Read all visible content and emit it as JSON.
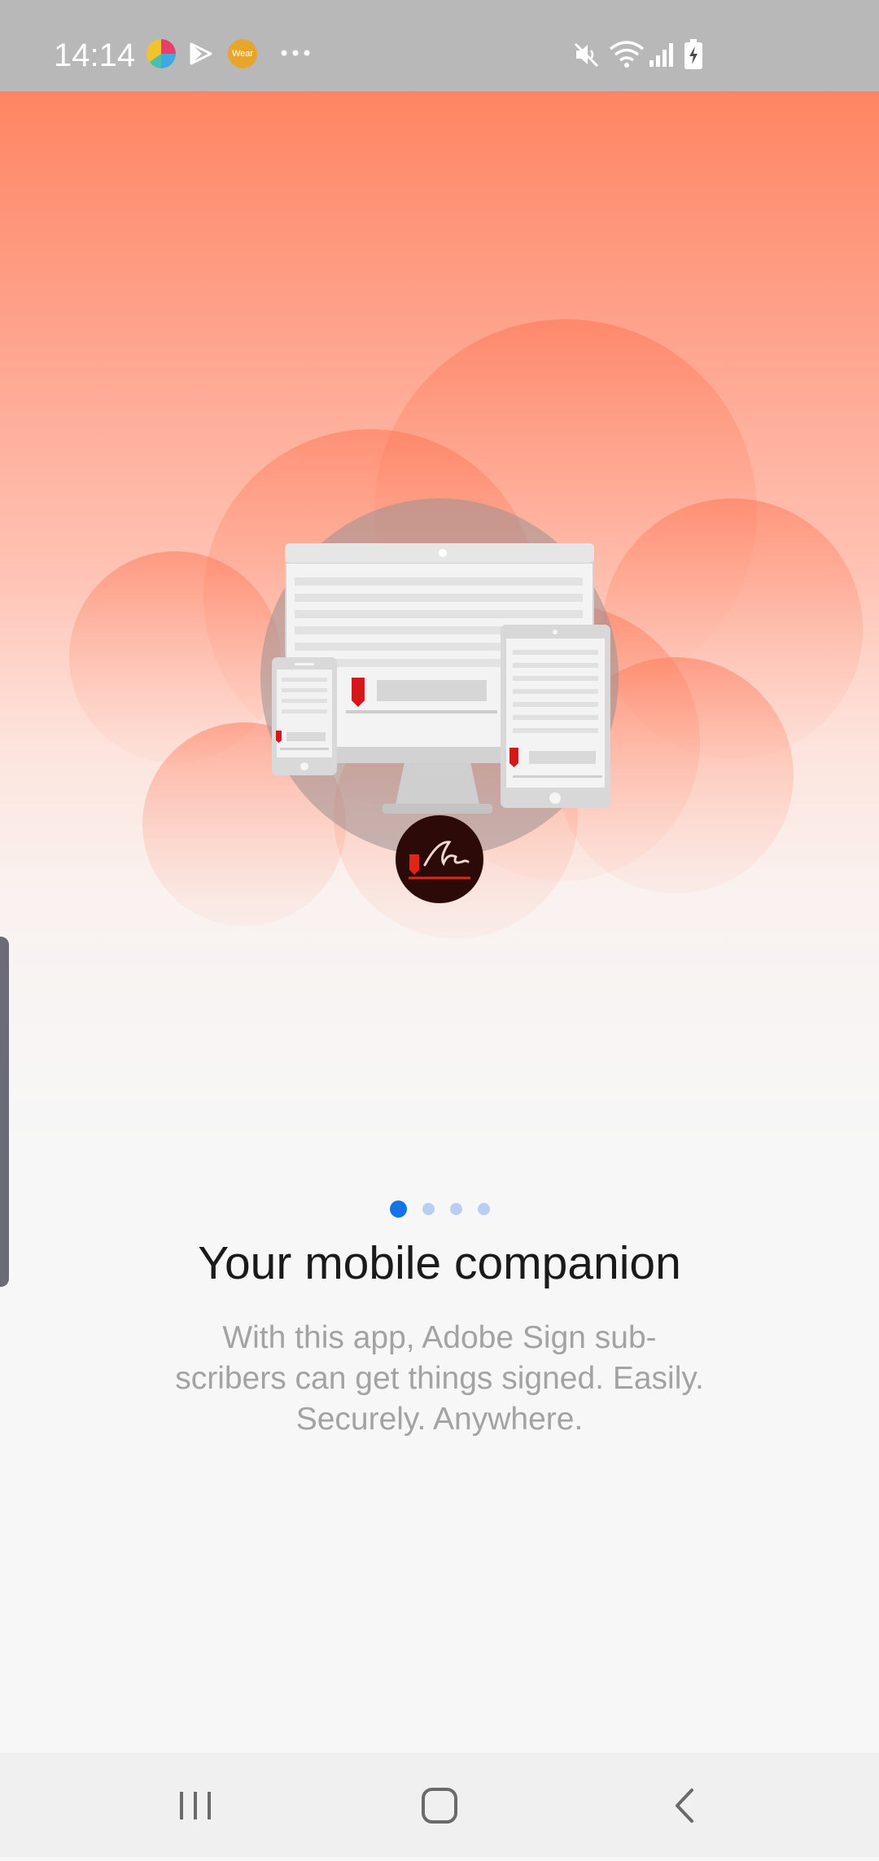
{
  "status_bar": {
    "time": "14:14",
    "notification_icons": [
      "color-circle-app-icon",
      "play-store-icon",
      "wear-app-icon",
      "more-dots-icon"
    ],
    "wear_label": "Wear",
    "system_icons": [
      "mute-icon",
      "wifi-icon",
      "signal-icon",
      "battery-charging-icon"
    ]
  },
  "onboarding": {
    "illustration": "devices-in-cloud-illustration",
    "logo": "adobe-sign-logo-icon",
    "page_count": 4,
    "current_page": 1,
    "title": "Your mobile companion",
    "subtitle": "With this app, Adobe Sign sub-scribers can get things signed. Easily. Securely. Anywhere."
  },
  "colors": {
    "hero_top": "#ff8563",
    "accent_blue": "#1473e6",
    "inactive_dot": "#b8cff2",
    "title_text": "#1a1a1a",
    "subtitle_text": "#a3a3a3",
    "logo_red": "#e1251b",
    "logo_dark": "#2b0a08"
  },
  "nav_bar": {
    "buttons": [
      "recent-apps-icon",
      "home-icon",
      "back-icon"
    ]
  }
}
